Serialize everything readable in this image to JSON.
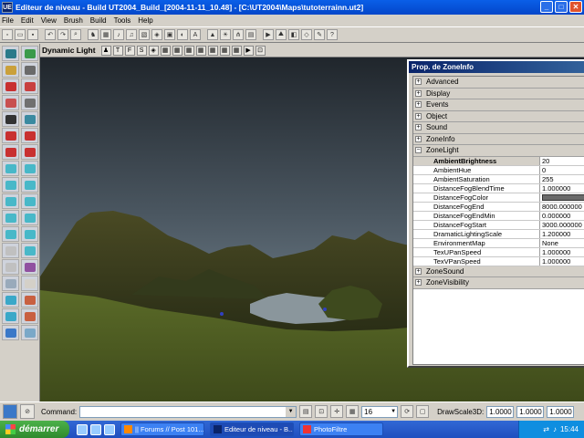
{
  "window": {
    "title": "Editeur de niveau - Build UT2004_Build_[2004-11-11_10.48] - [C:\\UT2004\\Maps\\tutoterrainn.ut2]",
    "app_icon": "UE"
  },
  "menu": [
    "File",
    "Edit",
    "View",
    "Brush",
    "Build",
    "Tools",
    "Help"
  ],
  "viewport": {
    "title": "Dynamic Light",
    "buttons": [
      "T",
      "F",
      "S"
    ]
  },
  "props": {
    "title": "Prop. de ZoneInfo",
    "categories_top": [
      "Advanced",
      "Display",
      "Events",
      "Object",
      "Sound",
      "ZoneInfo"
    ],
    "open_category": "ZoneLight",
    "rows": [
      {
        "key": "AmbientBrightness",
        "value": "20"
      },
      {
        "key": "AmbientHue",
        "value": "0"
      },
      {
        "key": "AmbientSaturation",
        "value": "255"
      },
      {
        "key": "DistanceFogBlendTime",
        "value": "1.000000"
      },
      {
        "key": "DistanceFogColor",
        "value": ""
      },
      {
        "key": "DistanceFogEnd",
        "value": "8000.000000"
      },
      {
        "key": "DistanceFogEndMin",
        "value": "0.000000"
      },
      {
        "key": "DistanceFogStart",
        "value": "3000.000000"
      },
      {
        "key": "DramaticLightingScale",
        "value": "1.200000"
      },
      {
        "key": "EnvironmentMap",
        "value": "None"
      },
      {
        "key": "TexUPanSpeed",
        "value": "1.000000"
      },
      {
        "key": "TexVPanSpeed",
        "value": "1.000000"
      }
    ],
    "categories_bottom": [
      "ZoneSound",
      "ZoneVisibility"
    ]
  },
  "status": {
    "command_label": "Command:",
    "grid_value": "16",
    "drawscale_label": "DrawScale3D:",
    "drawscale": [
      "1.0000",
      "1.0000",
      "1.0000"
    ]
  },
  "taskbar": {
    "start_label": "démarrer",
    "tasks": [
      "|| Forums // Post 101...",
      "Editeur de niveau - B...",
      "PhotoFiltre"
    ],
    "clock": "15:44"
  }
}
